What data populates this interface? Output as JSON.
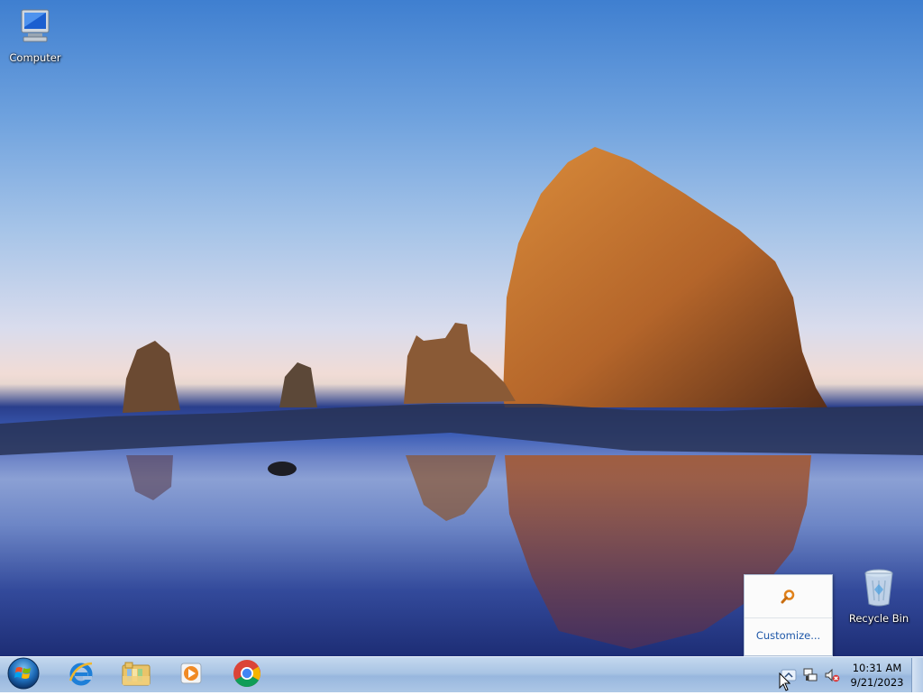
{
  "desktop": {
    "icons": [
      {
        "label": "Computer",
        "icon": "computer-icon"
      },
      {
        "label": "Recycle Bin",
        "icon": "recycle-bin-icon"
      }
    ]
  },
  "tray_popup": {
    "icon": "search-key-icon",
    "customize_label": "Customize..."
  },
  "taskbar": {
    "start": "windows-start-icon",
    "pinned": [
      {
        "name": "Internet Explorer",
        "icon": "internet-explorer-icon"
      },
      {
        "name": "Windows Explorer",
        "icon": "folder-library-icon"
      },
      {
        "name": "Windows Media Player",
        "icon": "media-player-icon"
      },
      {
        "name": "Google Chrome",
        "icon": "chrome-icon"
      }
    ],
    "tray": {
      "icons": [
        "show-hidden-icons-icon",
        "network-icon",
        "volume-muted-icon"
      ]
    },
    "clock": {
      "time": "10:31 AM",
      "date": "9/21/2023"
    }
  },
  "colors": {
    "taskbar": "#a9c4e4",
    "link": "#1e57a8"
  }
}
